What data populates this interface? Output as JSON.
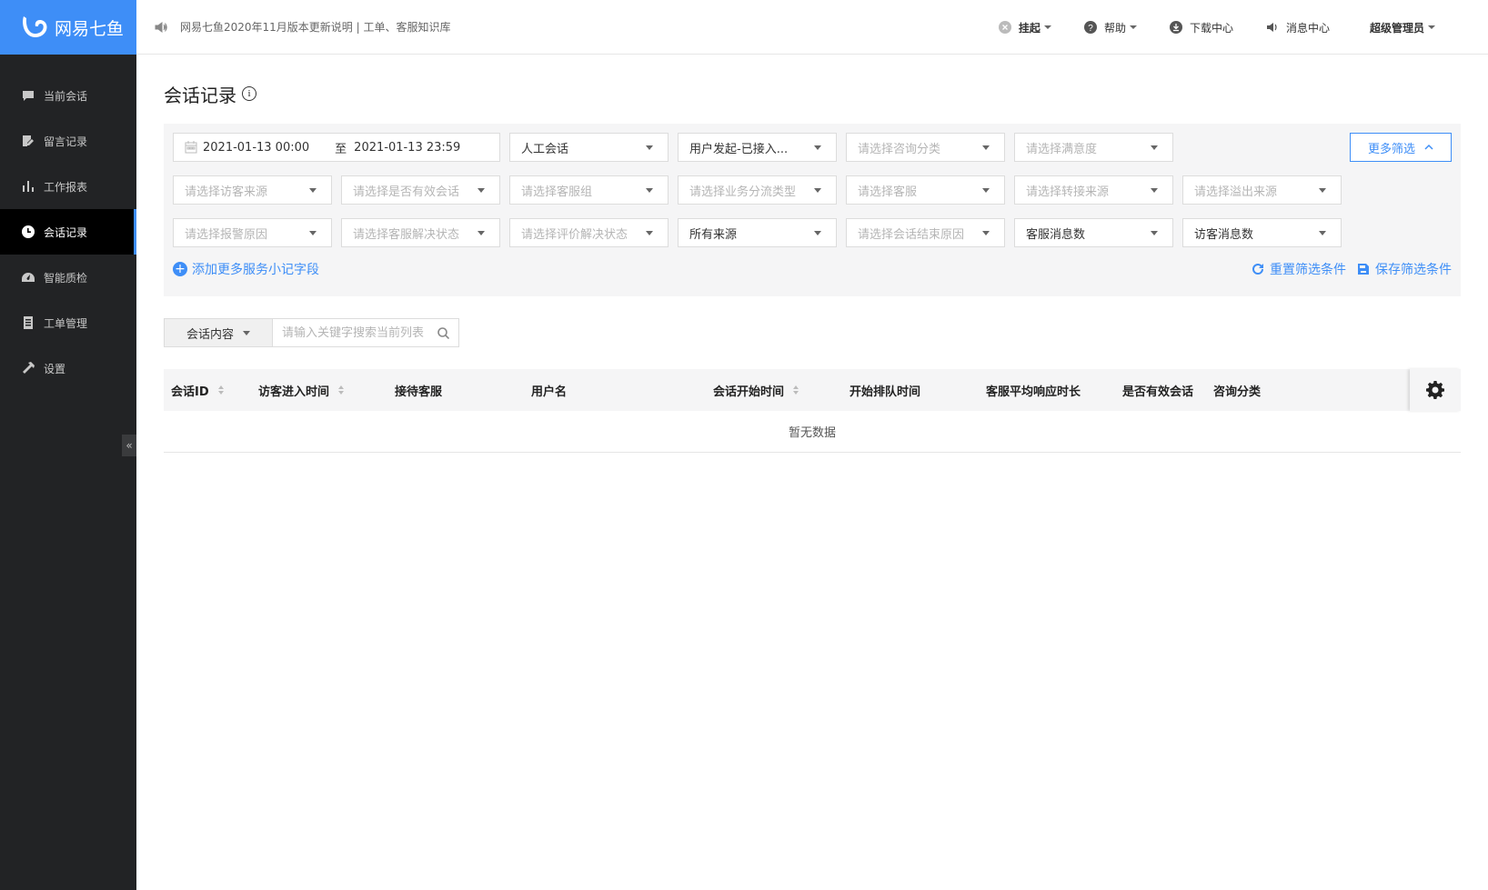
{
  "brand": {
    "name": "网易七鱼",
    "color": "#3e8ef7"
  },
  "sidebar": {
    "items": [
      {
        "label": "当前会话",
        "icon": "chat-icon"
      },
      {
        "label": "留言记录",
        "icon": "edit-note-icon"
      },
      {
        "label": "工作报表",
        "icon": "bar-chart-icon"
      },
      {
        "label": "会话记录",
        "icon": "clock-icon",
        "active": true
      },
      {
        "label": "智能质检",
        "icon": "dashboard-icon"
      },
      {
        "label": "工单管理",
        "icon": "document-icon"
      },
      {
        "label": "设置",
        "icon": "hammer-icon"
      }
    ],
    "collapse_label": "«"
  },
  "topbar": {
    "notice": "网易七鱼2020年11月版本更新说明 | 工单、客服知识库",
    "status": "挂起",
    "help": "帮助",
    "download": "下载中心",
    "messages": "消息中心",
    "user": "超级管理员"
  },
  "page": {
    "title": "会话记录",
    "info": "i"
  },
  "filters": {
    "date_start": "2021-01-13 00:00",
    "date_sep": "至",
    "date_end": "2021-01-13 23:59",
    "session_type": "人工会话",
    "initiator": "用户发起-已接入...",
    "consult_category": "请选择咨询分类",
    "satisfaction": "请选择满意度",
    "more_filters": "更多筛选",
    "visitor_source": "请选择访客来源",
    "valid_session": "请选择是否有效会话",
    "agent_group": "请选择客服组",
    "biz_type": "请选择业务分流类型",
    "agent": "请选择客服",
    "transfer_source": "请选择转接来源",
    "overflow_source": "请选择溢出来源",
    "alarm_reason": "请选择报警原因",
    "agent_resolve": "请选择客服解决状态",
    "eval_resolve": "请选择评价解决状态",
    "all_sources": "所有来源",
    "end_reason": "请选择会话结束原因",
    "agent_msg_count": "客服消息数",
    "visitor_msg_count": "访客消息数",
    "add_fields": "添加更多服务小记字段",
    "reset": "重置筛选条件",
    "save": "保存筛选条件"
  },
  "search": {
    "scope": "会话内容",
    "placeholder": "请输入关键字搜索当前列表"
  },
  "table": {
    "columns": [
      "会话ID",
      "访客进入时间",
      "接待客服",
      "用户名",
      "会话开始时间",
      "开始排队时间",
      "客服平均响应时长",
      "是否有效会话",
      "咨询分类"
    ],
    "empty_text": "暂无数据"
  }
}
